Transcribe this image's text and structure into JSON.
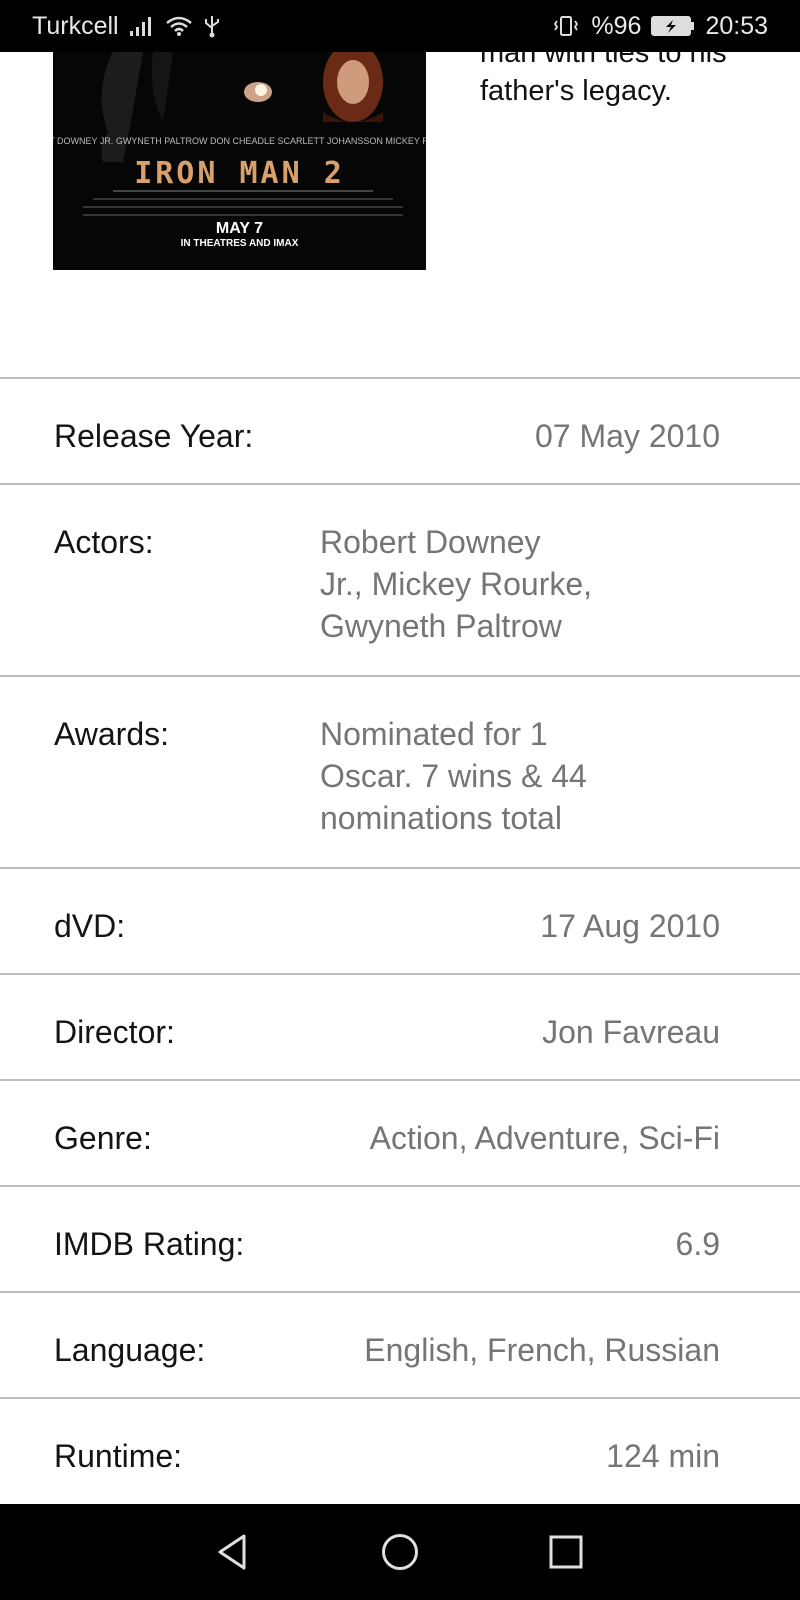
{
  "status_bar": {
    "carrier": "Turkcell",
    "battery": "%96",
    "time": "20:53"
  },
  "movie": {
    "plot_lines": [
      "man with ties to his",
      "father's legacy."
    ],
    "poster": {
      "title": "IRON MAN 2",
      "date": "MAY 7",
      "tagline": "IN THEATRES AND IMAX",
      "cast": "ROBERT DOWNEY JR.  GWYNETH PALTROW  DON CHEADLE  SCARLETT JOHANSSON  MICKEY ROURKE"
    }
  },
  "details": [
    {
      "label": "Release Year:",
      "value": "07 May 2010"
    },
    {
      "label": "Actors:",
      "value": [
        "Robert Downey",
        "Jr., Mickey Rourke,",
        "Gwyneth Paltrow"
      ]
    },
    {
      "label": "Awards:",
      "value": [
        "Nominated for 1",
        "Oscar. 7 wins & 44",
        "nominations total"
      ]
    },
    {
      "label": "dVD:",
      "value": "17 Aug 2010"
    },
    {
      "label": "Director:",
      "value": "Jon Favreau"
    },
    {
      "label": "Genre:",
      "value": "Action, Adventure, Sci-Fi"
    },
    {
      "label": "IMDB Rating:",
      "value": "6.9"
    },
    {
      "label": "Language:",
      "value": "English, French, Russian"
    },
    {
      "label": "Runtime:",
      "value": "124 min"
    }
  ],
  "nav_bar": {
    "back_icon": "back-triangle-icon",
    "home_icon": "home-circle-icon",
    "recents_icon": "recents-square-icon"
  }
}
